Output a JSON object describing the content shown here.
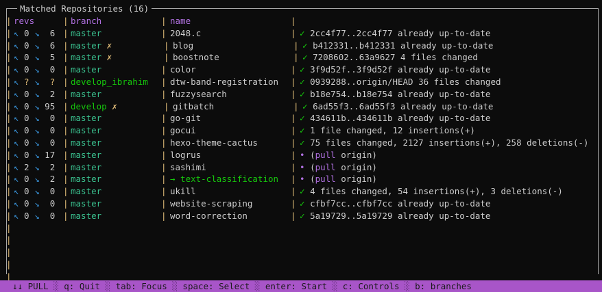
{
  "title": "Matched Repositories (16)",
  "headers": {
    "revs": "revs",
    "branch": "branch",
    "name": "name"
  },
  "rows": [
    {
      "revs_up": "↖",
      "revs_up_n": "0",
      "revs_down": "↘",
      "revs_down_n": "6",
      "branch": "master",
      "branch_mark": "",
      "name": "2048.c",
      "status_icon": "✓",
      "status_prefix": "",
      "status_pull": "",
      "status_suffix": "",
      "status": "2cc4f77..2cc4f77 already up-to-date"
    },
    {
      "revs_up": "↖",
      "revs_up_n": "0",
      "revs_down": "↘",
      "revs_down_n": "6",
      "branch": "master",
      "branch_mark": "✗",
      "name": "blog",
      "status_icon": "✓",
      "status": "b412331..b412331 already up-to-date"
    },
    {
      "revs_up": "↖",
      "revs_up_n": "0",
      "revs_down": "↘",
      "revs_down_n": "5",
      "branch": "master",
      "branch_mark": "✗",
      "name": "boostnote",
      "status_icon": "✓",
      "status": "7208602..63a9627 4 files changed"
    },
    {
      "revs_up": "↖",
      "revs_up_n": "0",
      "revs_down": "↘",
      "revs_down_n": "0",
      "branch": "master",
      "branch_mark": "",
      "name": "color",
      "status_icon": "✓",
      "status": "3f9d52f..3f9d52f already up-to-date"
    },
    {
      "revs_up": "↖",
      "revs_up_n": "?",
      "revs_down": "↘",
      "revs_down_n": "?",
      "branch": "develop_ibrahim",
      "branch_mark": "",
      "name": "dtw-band-registration",
      "status_icon": "✓",
      "status": "0939288..origin/HEAD 36 files changed"
    },
    {
      "revs_up": "↖",
      "revs_up_n": "0",
      "revs_down": "↘",
      "revs_down_n": "2",
      "branch": "master",
      "branch_mark": "",
      "name": "fuzzysearch",
      "status_icon": "✓",
      "status": "b18e754..b18e754 already up-to-date"
    },
    {
      "revs_up": "↖",
      "revs_up_n": "0",
      "revs_down": "↘",
      "revs_down_n": "95",
      "branch": "develop",
      "branch_mark": "✗",
      "name": "gitbatch",
      "status_icon": "✓",
      "status": "6ad55f3..6ad55f3 already up-to-date"
    },
    {
      "revs_up": "↖",
      "revs_up_n": "0",
      "revs_down": "↘",
      "revs_down_n": "0",
      "branch": "master",
      "branch_mark": "",
      "name": "go-git",
      "status_icon": "✓",
      "status": "434611b..434611b already up-to-date"
    },
    {
      "revs_up": "↖",
      "revs_up_n": "0",
      "revs_down": "↘",
      "revs_down_n": "0",
      "branch": "master",
      "branch_mark": "",
      "name": "gocui",
      "status_icon": "✓",
      "status": "1 file changed, 12 insertions(+)"
    },
    {
      "revs_up": "↖",
      "revs_up_n": "0",
      "revs_down": "↘",
      "revs_down_n": "0",
      "branch": "master",
      "branch_mark": "",
      "name": "hexo-theme-cactus",
      "status_icon": "✓",
      "status": "75 files changed, 2127 insertions(+), 258 deletions(-)"
    },
    {
      "revs_up": "↖",
      "revs_up_n": "0",
      "revs_down": "↘",
      "revs_down_n": "17",
      "branch": "master",
      "branch_mark": "",
      "name": "logrus",
      "status_icon": "•",
      "status_prefix": "(",
      "status_pull": "pull",
      "status_suffix": " origin)"
    },
    {
      "revs_up": "↖",
      "revs_up_n": "2",
      "revs_down": "↘",
      "revs_down_n": "2",
      "branch": "master",
      "branch_mark": "",
      "name": "sashimi",
      "status_icon": "•",
      "status_prefix": "(",
      "status_pull": "pull",
      "status_suffix": " origin)"
    },
    {
      "revs_up": "↖",
      "revs_up_n": "0",
      "revs_down": "↘",
      "revs_down_n": "2",
      "branch": "master",
      "branch_mark": "",
      "name": "→ text-classification",
      "status_icon": "•",
      "status_prefix": "(",
      "status_pull": "pull",
      "status_suffix": " origin)"
    },
    {
      "revs_up": "↖",
      "revs_up_n": "0",
      "revs_down": "↘",
      "revs_down_n": "0",
      "branch": "master",
      "branch_mark": "",
      "name": "ukill",
      "status_icon": "✓",
      "status": "4 files changed, 54 insertions(+), 3 deletions(-)"
    },
    {
      "revs_up": "↖",
      "revs_up_n": "0",
      "revs_down": "↘",
      "revs_down_n": "0",
      "branch": "master",
      "branch_mark": "",
      "name": "website-scraping",
      "status_icon": "✓",
      "status": "cfbf7cc..cfbf7cc already up-to-date"
    },
    {
      "revs_up": "↖",
      "revs_up_n": "0",
      "revs_down": "↘",
      "revs_down_n": "0",
      "branch": "master",
      "branch_mark": "",
      "name": "word-correction",
      "status_icon": "✓",
      "status": "5a19729..5a19729 already up-to-date"
    }
  ],
  "footer": {
    "mode": "↓↓ PULL",
    "items": [
      "q: Quit",
      "tab: Focus",
      "space: Select",
      "enter: Start",
      "c: Controls",
      "b: branches"
    ],
    "separator": "░"
  },
  "colors": {
    "background": "#0c0c0c",
    "footer_bg": "#a855c8",
    "check": "#16c60c",
    "accent_purple": "#b070e0",
    "separator_yellow": "#e5c07b",
    "arrow_blue": "#3a96dd"
  }
}
